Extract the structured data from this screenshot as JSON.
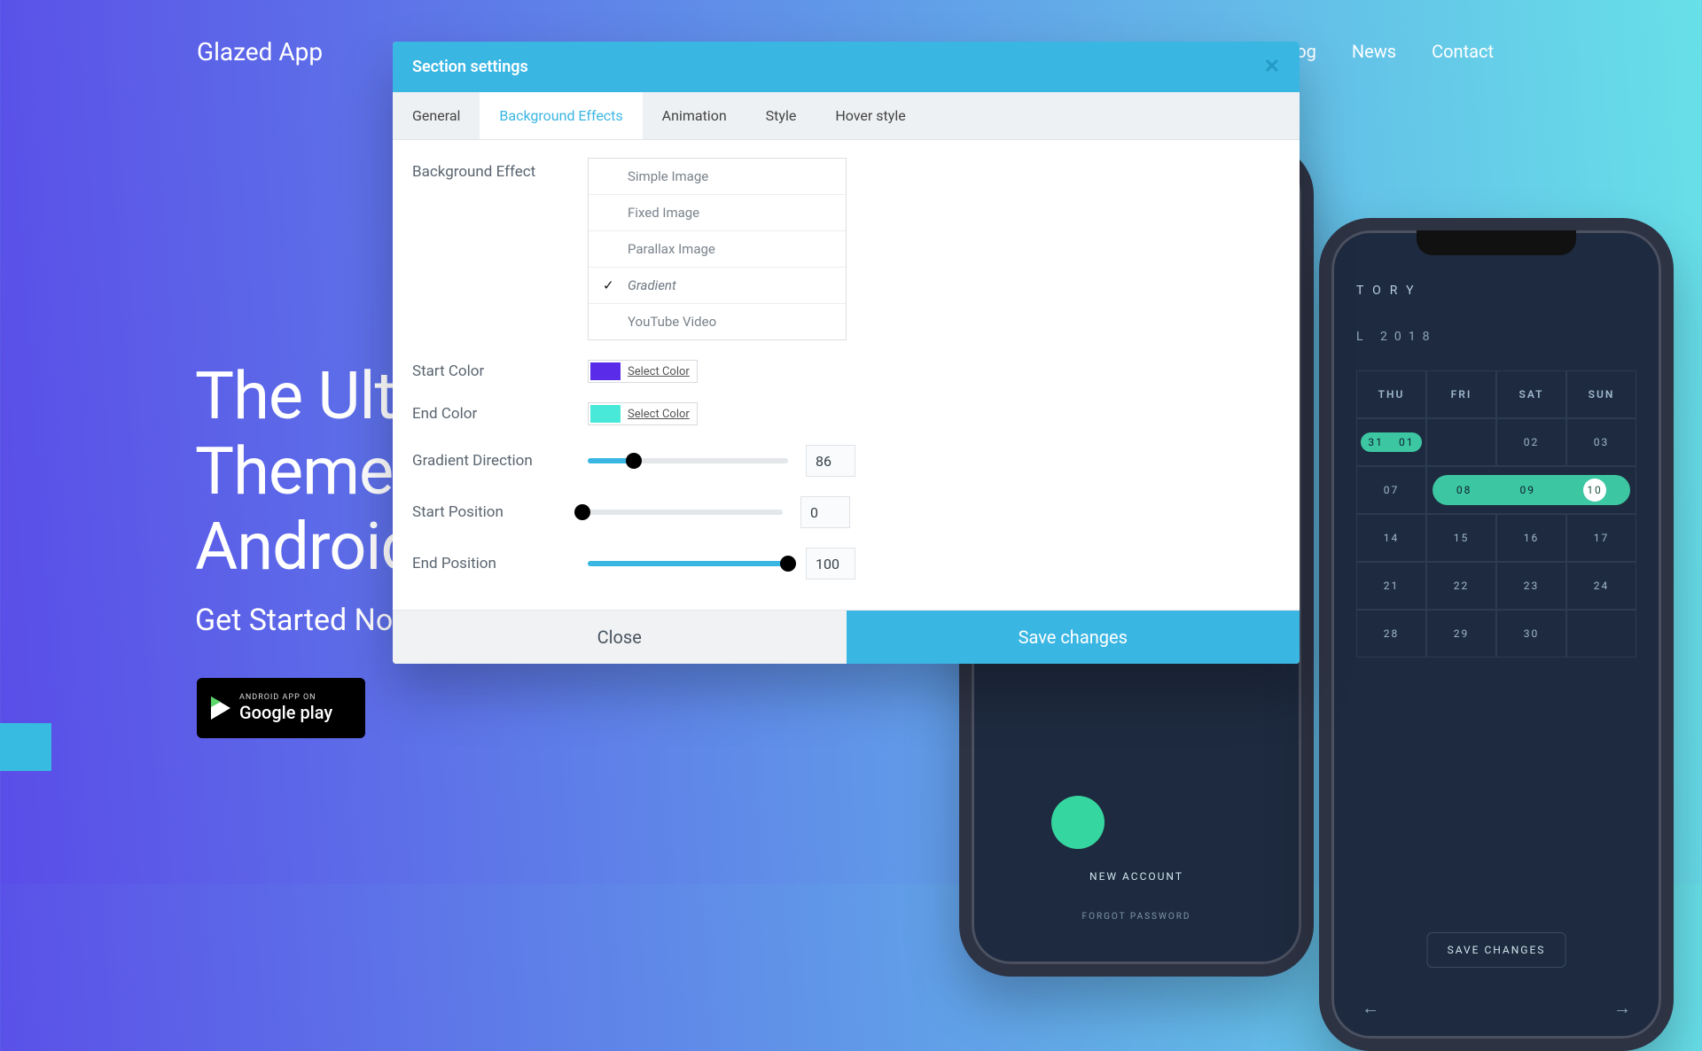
{
  "brand": "Glazed App",
  "nav": {
    "item0": "log",
    "item1": "News",
    "item2": "Contact"
  },
  "hero": {
    "line1": "The Ultim",
    "line2": "Theme F",
    "line3": "Android",
    "sub": "Get Started No"
  },
  "gplay": {
    "small": "ANDROID APP ON",
    "big": "Google play"
  },
  "phone1": {
    "title": "TORY",
    "sub": "L  2018",
    "head": [
      "THU",
      "FRI",
      "SAT",
      "SUN"
    ],
    "rows": [
      [
        "31",
        "01",
        "02",
        "03"
      ],
      [
        "07",
        "08",
        "09",
        "10"
      ],
      [
        "14",
        "15",
        "16",
        "17"
      ],
      [
        "21",
        "22",
        "23",
        "24"
      ],
      [
        "28",
        "29",
        "30",
        ""
      ]
    ],
    "newacc": "NEW ACCOUNT",
    "forgot": "FORGOT PASSWORD"
  },
  "phone2": {
    "btn": "SAVE CHANGES"
  },
  "modal": {
    "title": "Section settings",
    "tabs": {
      "t0": "General",
      "t1": "Background Effects",
      "t2": "Animation",
      "t3": "Style",
      "t4": "Hover style"
    },
    "labels": {
      "bg": "Background Effect",
      "start": "Start Color",
      "end": "End Color",
      "dir": "Gradient Direction",
      "spos": "Start Position",
      "epos": "End Position"
    },
    "options": {
      "o0": "Simple Image",
      "o1": "Fixed Image",
      "o2": "Parallax Image",
      "o3": "Gradient",
      "o4": "YouTube Video"
    },
    "selectColor": "Select Color",
    "colors": {
      "start": "#5a2be8",
      "end": "#49e9da"
    },
    "values": {
      "dir": "86",
      "spos": "0",
      "epos": "100"
    },
    "sliders": {
      "dir_pct": 23,
      "spos_pct": 0,
      "epos_pct": 100
    },
    "buttons": {
      "close": "Close",
      "save": "Save changes"
    }
  }
}
